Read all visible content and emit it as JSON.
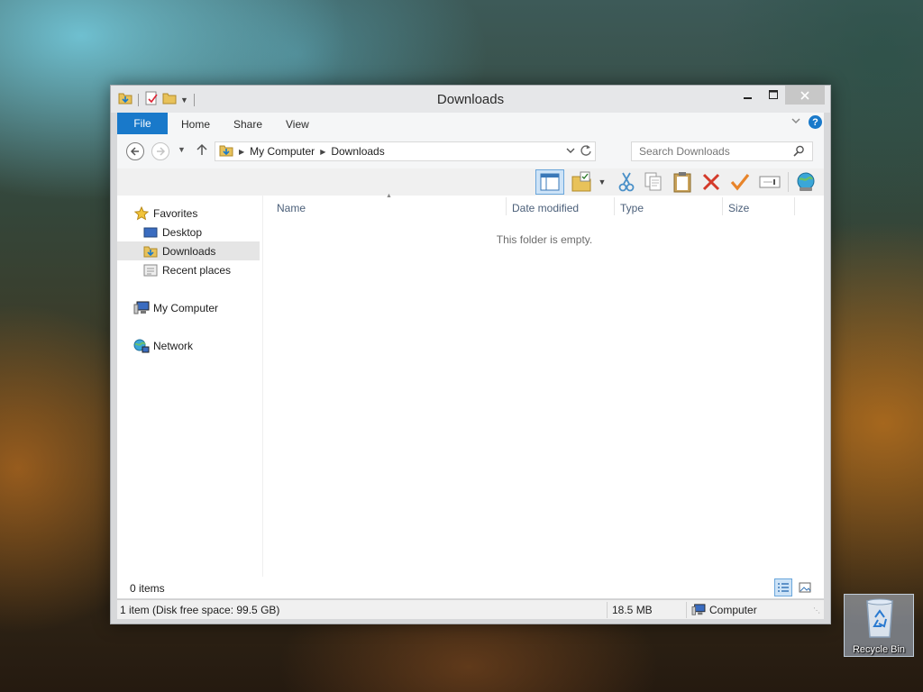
{
  "window": {
    "title": "Downloads"
  },
  "ribbon": {
    "file_tab": "File",
    "tabs": [
      "Home",
      "Share",
      "View"
    ]
  },
  "address": {
    "breadcrumbs": [
      "My Computer",
      "Downloads"
    ],
    "search_placeholder": "Search Downloads"
  },
  "toolbar": {
    "buttons": [
      "layout-pane",
      "select-all-folder",
      "cut",
      "copy",
      "paste",
      "delete",
      "properties",
      "rename",
      "network"
    ]
  },
  "navigation": {
    "favorites_label": "Favorites",
    "favorites": [
      "Desktop",
      "Downloads",
      "Recent places"
    ],
    "selected": "Downloads",
    "computer_label": "My Computer",
    "network_label": "Network"
  },
  "file_list": {
    "columns": [
      "Name",
      "Date modified",
      "Type",
      "Size"
    ],
    "empty_message": "This folder is empty."
  },
  "footer": {
    "item_count": "0 items"
  },
  "status_bar": {
    "selection_info": "1 item (Disk free space: 99.5 GB)",
    "size": "18.5 MB",
    "location": "Computer"
  },
  "desktop": {
    "recycle_bin_label": "Recycle Bin"
  },
  "colors": {
    "accent": "#1979ca",
    "selection": "#cde3f7",
    "selection_border": "#6aa6db",
    "close_button": "#c7c7c7"
  }
}
